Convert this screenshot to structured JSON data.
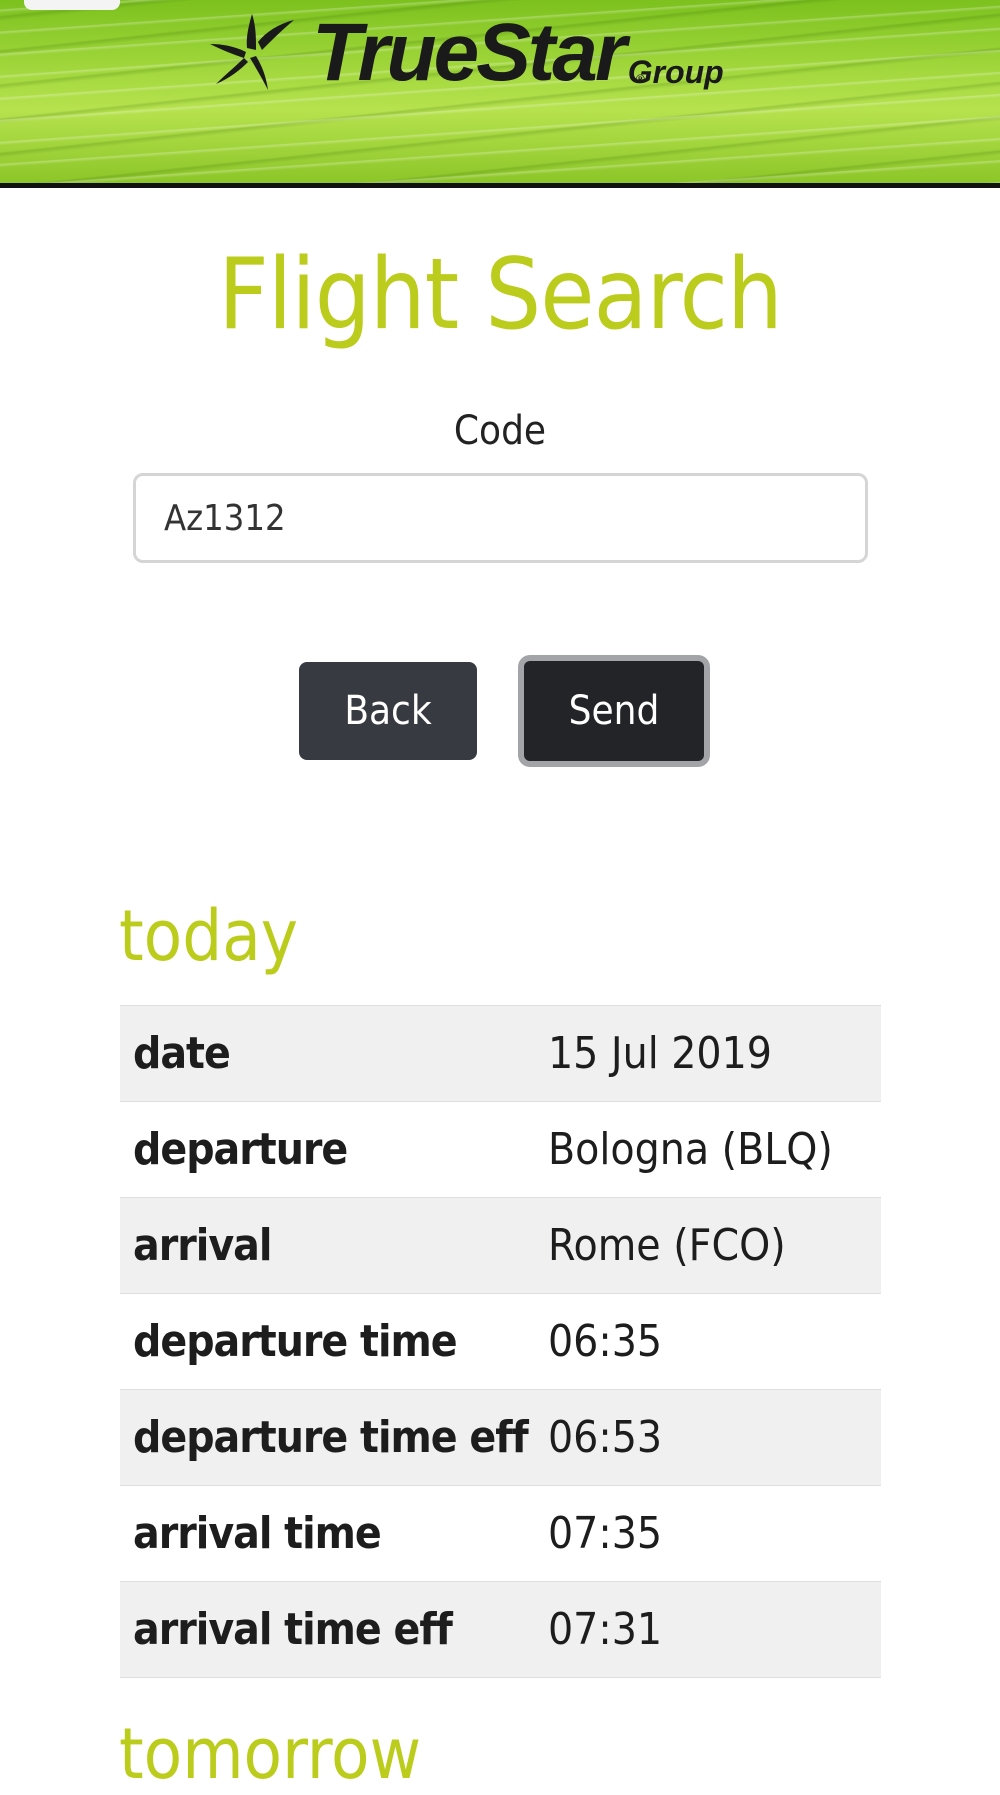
{
  "header": {
    "logo_name": "TrueStar",
    "logo_suffix": "Group",
    "logo_mark": "star-swirl-icon",
    "brand_green": "#8cc628"
  },
  "page": {
    "title": "Flight Search",
    "accent_color": "#bccc1c"
  },
  "form": {
    "code_label": "Code",
    "code_value": "Az1312",
    "back_label": "Back",
    "send_label": "Send"
  },
  "results": {
    "today_heading": "today",
    "tomorrow_heading": "tomorrow",
    "today": [
      {
        "key": "date",
        "value": "15 Jul 2019"
      },
      {
        "key": "departure",
        "value": "Bologna (BLQ)"
      },
      {
        "key": "arrival",
        "value": "Rome (FCO)"
      },
      {
        "key": "departure time",
        "value": "06:35"
      },
      {
        "key": "departure time eff",
        "value": "06:53"
      },
      {
        "key": "arrival time",
        "value": "07:35"
      },
      {
        "key": "arrival time eff",
        "value": "07:31"
      }
    ]
  }
}
